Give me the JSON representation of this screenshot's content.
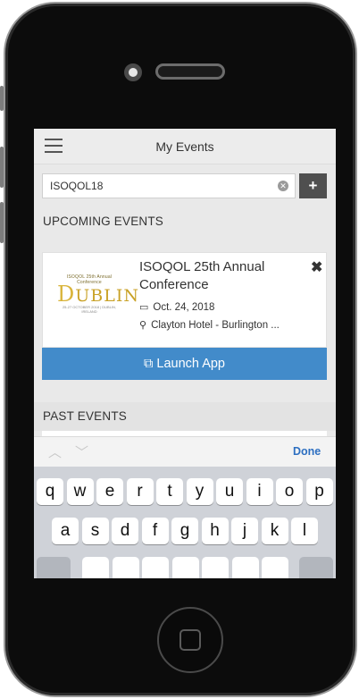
{
  "header": {
    "title": "My Events",
    "menu_icon": "hamburger-icon"
  },
  "search": {
    "value": "ISOQOL18",
    "clear_icon": "clear-icon",
    "add_label": "+"
  },
  "upcoming": {
    "heading": "UPCOMING EVENTS",
    "event": {
      "logo_lines": [
        "ISOQOL 25th Annual Conference",
        "UBLIN",
        "D",
        "25-27 OCTOBER 2018 | DUBLIN, IRELAND"
      ],
      "title": "ISOQOL 25th Annual Conference",
      "date": "Oct. 24, 2018",
      "venue": "Clayton Hotel - Burlington ...",
      "remove_label": "✖"
    },
    "launch_label": "Launch App",
    "launch_icon": "external-link-icon"
  },
  "past": {
    "heading": "PAST EVENTS"
  },
  "keyboard": {
    "done_label": "Done",
    "row1": [
      "q",
      "w",
      "e",
      "r",
      "t",
      "y",
      "u",
      "i",
      "o",
      "p"
    ],
    "row2": [
      "a",
      "s",
      "d",
      "f",
      "g",
      "h",
      "j",
      "k",
      "l"
    ]
  },
  "colors": {
    "accent": "#428bca",
    "add_button": "#4f4f4f",
    "done": "#2d6fc1"
  }
}
